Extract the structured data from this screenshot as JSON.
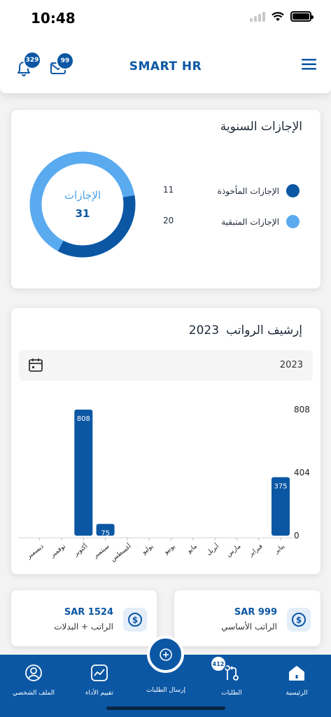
{
  "status_bar": {
    "time": "10:48"
  },
  "header": {
    "title": "SMART HR",
    "notifications_count": "329",
    "messages_count": "99"
  },
  "annual_leave": {
    "title": "الإجازات السنوية",
    "donut_label": "الإجازات",
    "donut_total": "31",
    "legend": [
      {
        "label": "الإجازات المأخوذة",
        "value": "11",
        "color": "#0b57a4"
      },
      {
        "label": "الإجازات المتبقية",
        "value": "20",
        "color": "#5aaaf0"
      }
    ]
  },
  "payroll_archive": {
    "title": "إرشيف الرواتب",
    "year": "2023",
    "year_selector": "2023"
  },
  "chart_data": {
    "type": "bar",
    "categories": [
      "يناير",
      "فبراير",
      "مارس",
      "أبريل",
      "مايو",
      "يونيو",
      "يوليو",
      "أغسطس",
      "سبتمبر",
      "أكتوبر",
      "نوفمبر",
      "ديسمبر"
    ],
    "values": [
      375,
      0,
      0,
      0,
      0,
      0,
      0,
      0,
      75,
      808,
      0,
      0
    ],
    "data_labels": [
      "375",
      "",
      "",
      "",
      "",
      "",
      "",
      "",
      "75",
      "808",
      "",
      ""
    ],
    "y_ticks": [
      "0",
      "404",
      "808"
    ],
    "ylim": [
      0,
      808
    ],
    "bar_color": "#0b57a4",
    "x_direction": "right-to-left"
  },
  "salary_cards": [
    {
      "amount": "SAR 999",
      "label": "الراتب الأساسي"
    },
    {
      "amount": "SAR 1524",
      "label": "الراتب + البدلات"
    }
  ],
  "bottom_nav": {
    "items": [
      {
        "label": "الرئيسية",
        "icon": "home-icon"
      },
      {
        "label": "الطلبات",
        "icon": "requests-icon",
        "badge": "412"
      },
      {
        "label": "إرسال الطلبات",
        "icon": "add-icon"
      },
      {
        "label": "تقييم الأداء",
        "icon": "performance-icon"
      },
      {
        "label": "الملف الشخصي",
        "icon": "profile-icon"
      }
    ]
  },
  "colors": {
    "primary": "#0b57a4",
    "accent_light": "#5aaaf0"
  }
}
